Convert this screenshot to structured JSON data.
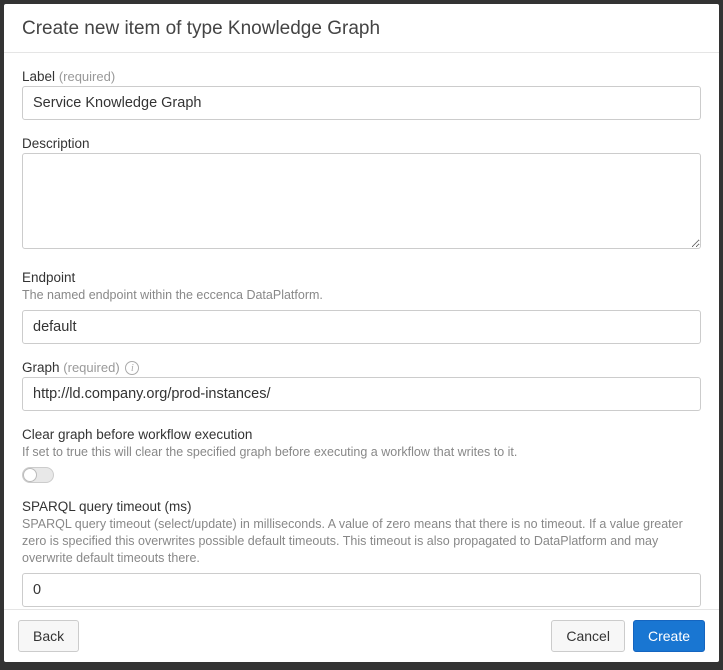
{
  "dialog": {
    "title": "Create new item of type Knowledge Graph"
  },
  "fields": {
    "label": {
      "label": "Label",
      "required_text": "(required)",
      "value": "Service Knowledge Graph"
    },
    "description": {
      "label": "Description",
      "value": ""
    },
    "endpoint": {
      "label": "Endpoint",
      "help": "The named endpoint within the eccenca DataPlatform.",
      "value": "default"
    },
    "graph": {
      "label": "Graph",
      "required_text": "(required)",
      "value": "http://ld.company.org/prod-instances/"
    },
    "clear_graph": {
      "label": "Clear graph before workflow execution",
      "help": "If set to true this will clear the specified graph before executing a workflow that writes to it.",
      "value": false
    },
    "timeout": {
      "label": "SPARQL query timeout (ms)",
      "help": "SPARQL query timeout (select/update) in milliseconds. A value of zero means that there is no timeout. If a value greater zero is specified this overwrites possible default timeouts. This timeout is also propagated to DataPlatform and may overwrite default timeouts there.",
      "value": "0"
    }
  },
  "footer": {
    "back": "Back",
    "cancel": "Cancel",
    "create": "Create"
  }
}
